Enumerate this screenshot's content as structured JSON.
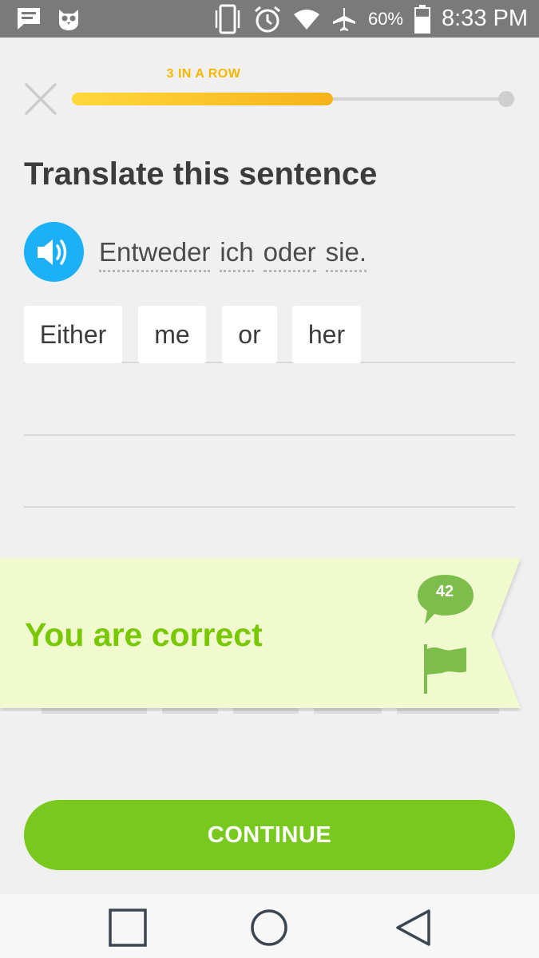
{
  "status_bar": {
    "icons_left": [
      "message-icon",
      "owl-icon"
    ],
    "icons_right": [
      "vibrate-icon",
      "alarm-icon",
      "wifi-icon",
      "airplane-icon"
    ],
    "battery_percent": "60%",
    "battery_level": 0.6,
    "time": "8:33 PM"
  },
  "header": {
    "close_icon": "close-icon",
    "streak_label": "3 IN A ROW",
    "progress": 0.6
  },
  "prompt": {
    "title": "Translate this sentence",
    "speaker_icon": "speaker-icon",
    "sentence_words": [
      "Entweder",
      "ich",
      "oder",
      "sie."
    ]
  },
  "answer": {
    "tiles": [
      "Either",
      "me",
      "or",
      "her"
    ]
  },
  "feedback": {
    "message": "You are correct",
    "comment_count": "42",
    "comment_icon": "comment-bubble-icon",
    "flag_icon": "flag-icon"
  },
  "continue_label": "CONTINUE",
  "navbar": {
    "icons": [
      "recents-square-icon",
      "home-circle-icon",
      "back-triangle-icon"
    ]
  },
  "colors": {
    "status_bar": "#7a7a7a",
    "streak": "#f5b800",
    "progress_start": "#ffd83c",
    "progress_end": "#f7b21a",
    "speaker": "#1cb0f6",
    "correct_text": "#78c800",
    "banner_bg": "#f1facf",
    "banner_accent": "#7dbd4b",
    "continue_bg": "#78c81e"
  }
}
